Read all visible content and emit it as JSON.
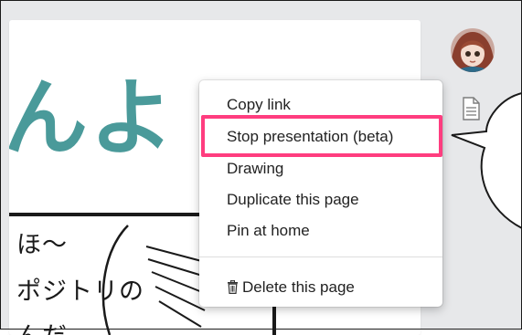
{
  "page": {
    "title_fragment": "んよ",
    "manga_lines": [
      "ほ〜",
      "ポジトリの",
      "んだ"
    ]
  },
  "right_rail": {
    "avatar_icon": "user-avatar",
    "page_icon": "document-icon"
  },
  "context_menu": {
    "items": [
      {
        "label": "Copy link"
      },
      {
        "label": "Stop presentation (beta)"
      },
      {
        "label": "Drawing"
      },
      {
        "label": "Duplicate this page"
      },
      {
        "label": "Pin at home"
      }
    ],
    "delete_label": "Delete this page",
    "delete_icon": "trash-icon"
  },
  "colors": {
    "highlight": "#ff3d7f",
    "title_teal": "#4a9a9a",
    "rail_bg": "#e7e8ea"
  }
}
